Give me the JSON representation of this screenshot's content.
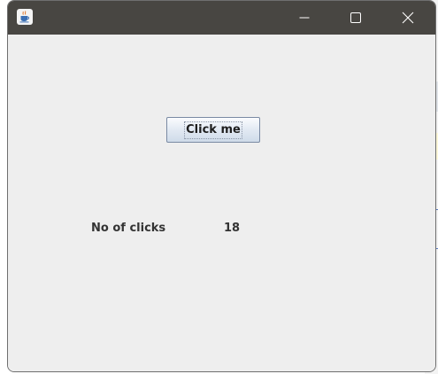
{
  "window": {
    "title": "",
    "icon": "java-cup-icon",
    "controls": [
      "minimize-icon",
      "maximize-icon",
      "close-icon"
    ]
  },
  "content": {
    "button_label": "Click me",
    "clicks_label": "No of clicks",
    "clicks_value": "18"
  },
  "colors": {
    "titlebar": "#484642",
    "client_background": "#eeeeee",
    "label_text": "#333333"
  }
}
